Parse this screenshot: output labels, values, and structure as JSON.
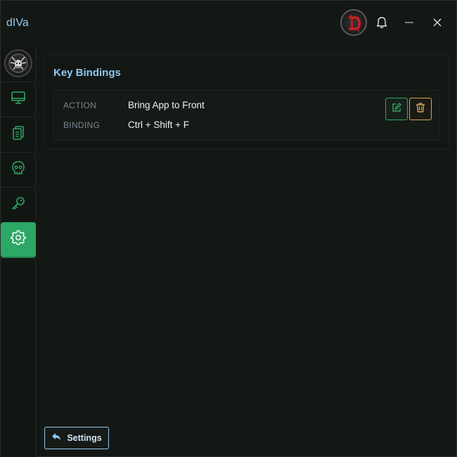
{
  "titlebar": {
    "app_title": "dIVa",
    "profile_icon": "diablo-logo-icon",
    "bell_icon": "bell-icon",
    "minimize_icon": "minimize-icon",
    "close_icon": "close-icon"
  },
  "sidebar": {
    "logo_icon": "demon-emblem-icon",
    "items": [
      {
        "icon": "monitor-icon",
        "active": false
      },
      {
        "icon": "clipboard-icon",
        "active": false
      },
      {
        "icon": "skull-icon",
        "active": false
      },
      {
        "icon": "key-icon",
        "active": false
      },
      {
        "icon": "gear-icon",
        "active": true
      }
    ]
  },
  "main": {
    "section_title": "Key Bindings",
    "binding": {
      "action_label": "ACTION",
      "action_value": "Bring App to Front",
      "binding_label": "BINDING",
      "binding_value": "Ctrl + Shift + F",
      "edit_icon": "edit-icon",
      "delete_icon": "trash-icon"
    }
  },
  "footer": {
    "back_label": "Settings",
    "back_icon": "reply-arrow-icon"
  },
  "colors": {
    "accent_green": "#2da765",
    "accent_blue": "#8fc8ef",
    "warning_gold": "#d4a452",
    "background": "#141815"
  }
}
